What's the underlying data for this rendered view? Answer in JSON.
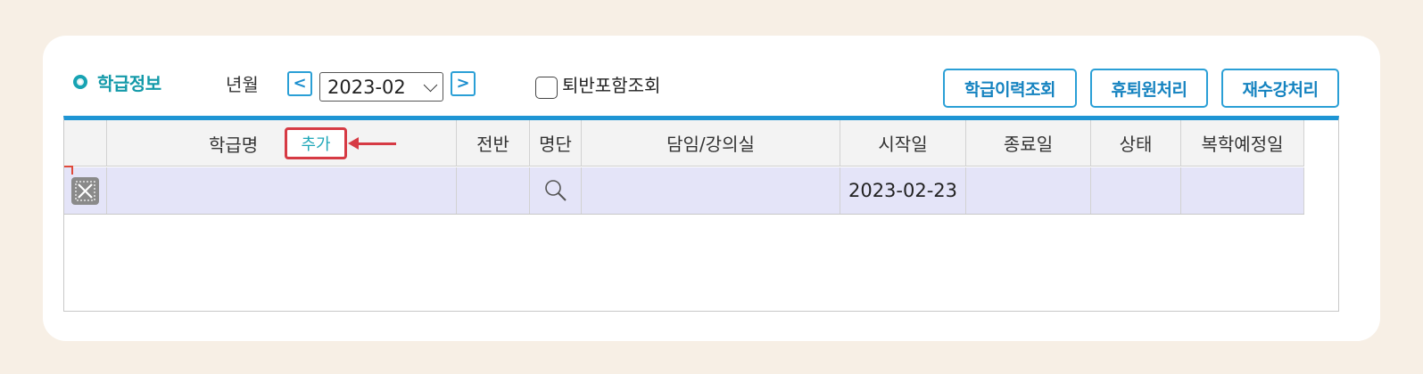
{
  "section": {
    "title": "학급정보"
  },
  "filter": {
    "year_month_label": "년월",
    "prev_icon": "chevron-left-icon",
    "next_icon": "chevron-right-icon",
    "prev_glyph": "<",
    "next_glyph": ">",
    "selected_month": "2023-02",
    "include_withdrawn_label": "퇴반포함조회",
    "include_withdrawn_checked": false
  },
  "actions": {
    "class_history": "학급이력조회",
    "leave_process": "휴퇴원처리",
    "retake_process": "재수강처리"
  },
  "grid": {
    "columns": [
      "",
      "학급명",
      "전반",
      "명단",
      "담임/강의실",
      "시작일",
      "종료일",
      "상태",
      "복학예정일"
    ],
    "add_button": "추가",
    "rows": [
      {
        "class_name": "",
        "transfer": "",
        "roster_icon": "search-icon",
        "teacher_room": "",
        "start_date": "2023-02-23",
        "end_date": "",
        "status": "",
        "return_date": ""
      }
    ]
  },
  "colors": {
    "accent": "#1e95d4",
    "title": "#149aa9",
    "highlight_border": "#d63a44",
    "row_background": "#e4e4f8",
    "page_background": "#f7efe5"
  }
}
